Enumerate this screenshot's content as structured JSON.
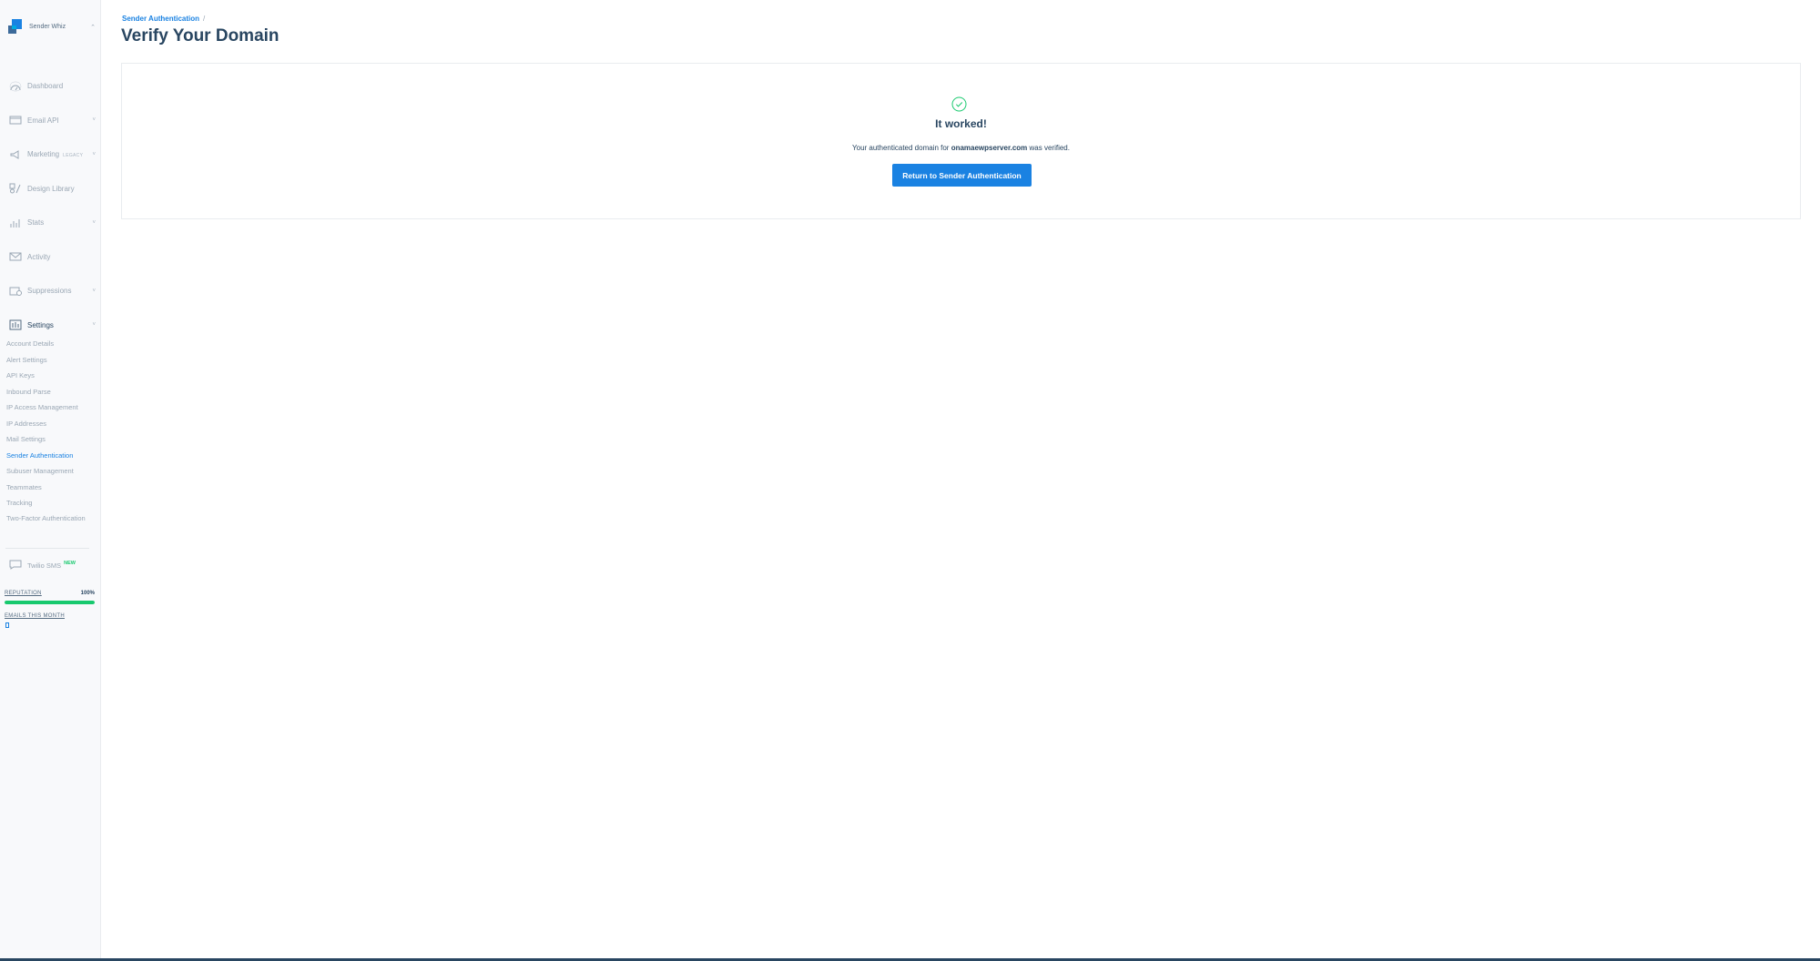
{
  "account": {
    "name": "Sender Whiz"
  },
  "nav": [
    {
      "label": "Dashboard",
      "icon": "dashboard-icon",
      "chevron": false,
      "badge": ""
    },
    {
      "label": "Email API",
      "icon": "email-api-icon",
      "chevron": true,
      "badge": ""
    },
    {
      "label": "Marketing",
      "icon": "marketing-icon",
      "chevron": true,
      "badge": "LEGACY"
    },
    {
      "label": "Design Library",
      "icon": "design-library-icon",
      "chevron": false,
      "badge": ""
    },
    {
      "label": "Stats",
      "icon": "stats-icon",
      "chevron": true,
      "badge": ""
    },
    {
      "label": "Activity",
      "icon": "activity-icon",
      "chevron": false,
      "badge": ""
    },
    {
      "label": "Suppressions",
      "icon": "suppressions-icon",
      "chevron": true,
      "badge": ""
    },
    {
      "label": "Settings",
      "icon": "settings-icon",
      "chevron": true,
      "badge": ""
    }
  ],
  "settings_sub": [
    "Account Details",
    "Alert Settings",
    "API Keys",
    "Inbound Parse",
    "IP Access Management",
    "IP Addresses",
    "Mail Settings",
    "Sender Authentication",
    "Subuser Management",
    "Teammates",
    "Tracking",
    "Two-Factor Authentication"
  ],
  "selected_sub": "Sender Authentication",
  "twilio": {
    "label": "Twilio SMS",
    "badge": "NEW"
  },
  "reputation": {
    "label": "REPUTATION",
    "value_text": "100%",
    "fraction": 1.0
  },
  "emails_this_month": {
    "label": "EMAILS THIS MONTH"
  },
  "breadcrumb": {
    "link": "Sender Authentication",
    "separator": "/"
  },
  "page": {
    "title": "Verify Your Domain"
  },
  "result": {
    "heading": "It worked!",
    "message_prefix": "Your authenticated domain for ",
    "domain": "onamaewpserver.com",
    "message_suffix": " was verified.",
    "button_label": "Return to Sender Authentication"
  },
  "colors": {
    "accent": "#1a82e2",
    "success": "#18c96e",
    "text_dark": "#294661"
  }
}
